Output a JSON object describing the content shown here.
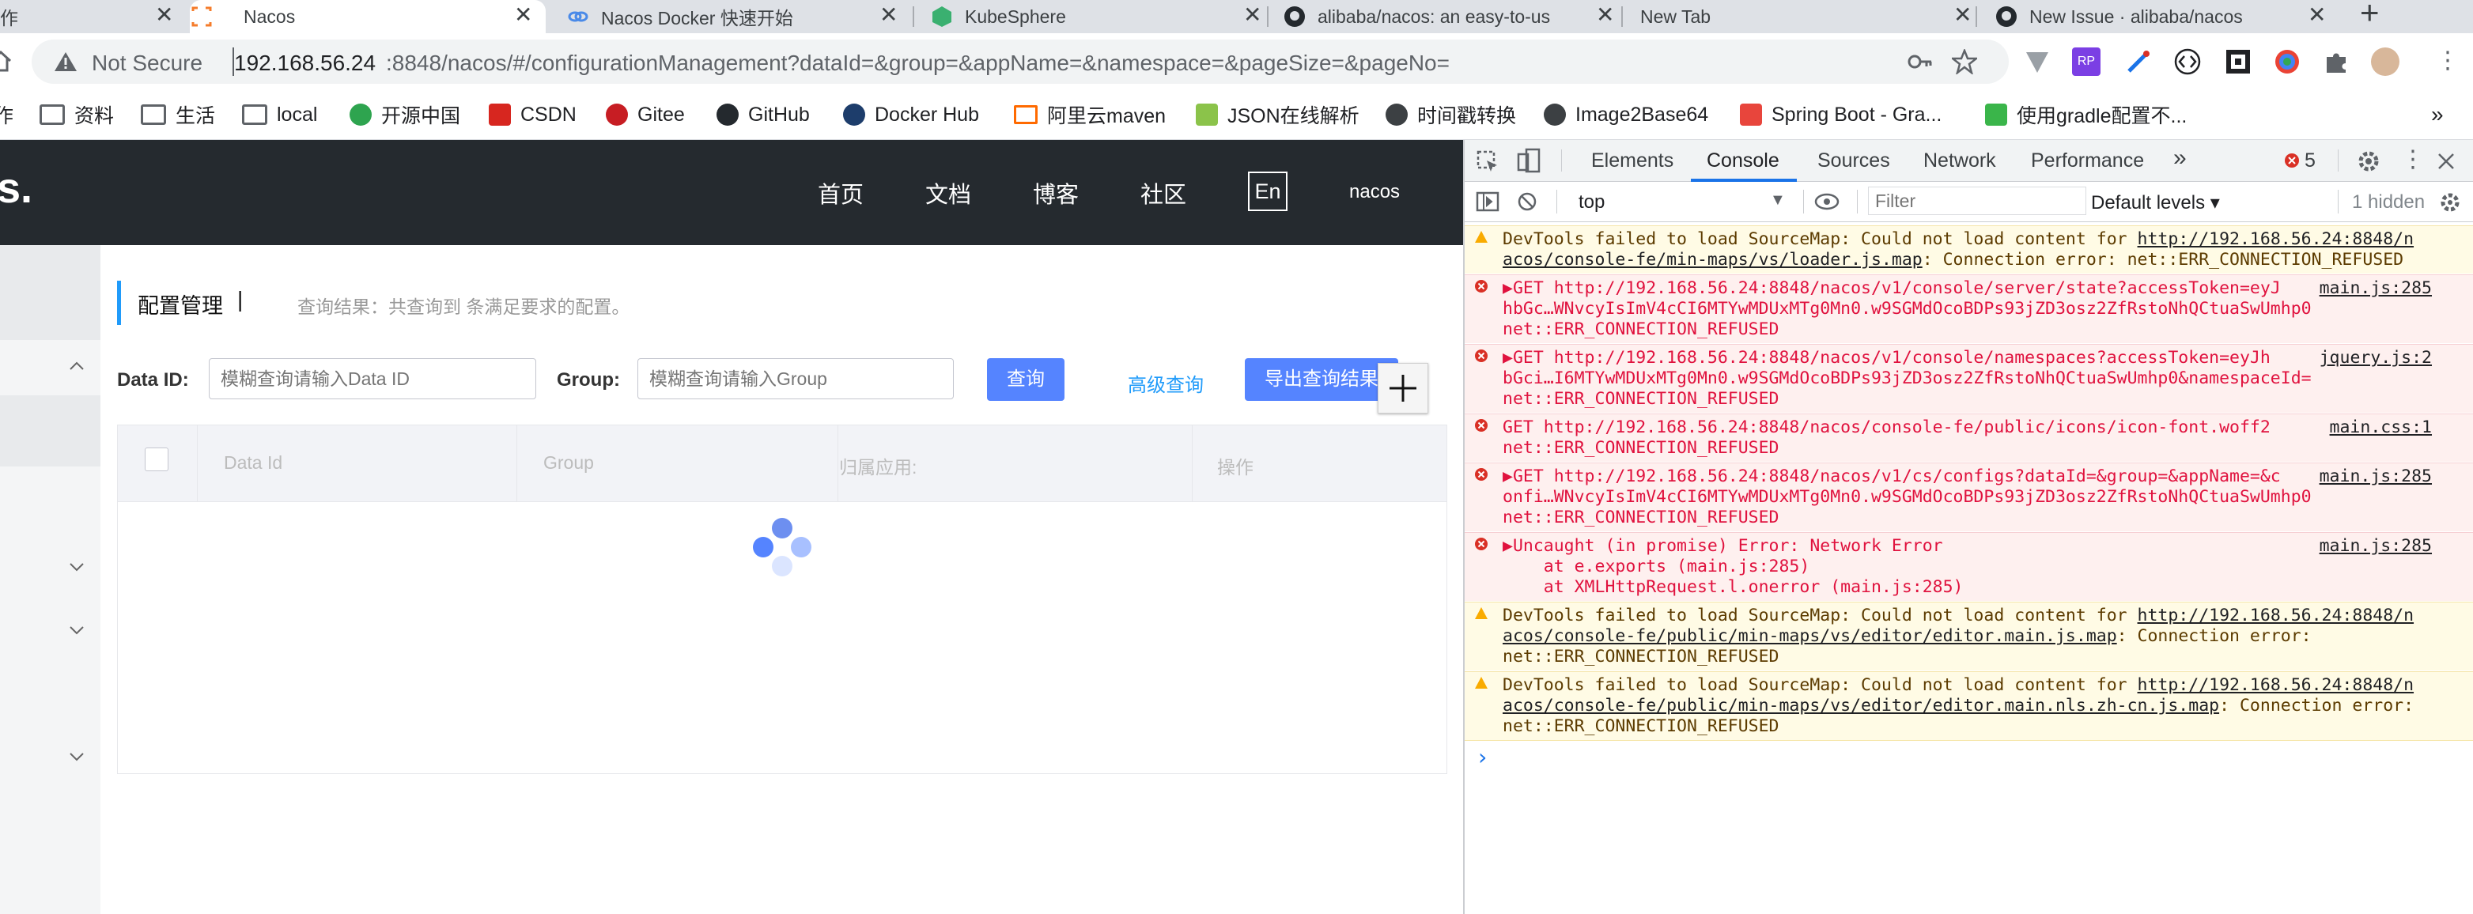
{
  "tabs": [
    {
      "title": "作",
      "close": "✕",
      "active": false
    },
    {
      "title": "Nacos",
      "close": "✕",
      "active": true
    },
    {
      "title": "Nacos Docker 快速开始",
      "close": "✕",
      "active": false
    },
    {
      "title": "KubeSphere",
      "close": "✕",
      "active": false
    },
    {
      "title": "alibaba/nacos: an easy-to-us",
      "close": "✕",
      "active": false
    },
    {
      "title": "New Tab",
      "close": "✕",
      "active": false
    },
    {
      "title": "New Issue · alibaba/nacos",
      "close": "✕",
      "active": false
    }
  ],
  "new_tab_symbol": "+",
  "address": {
    "security_label": "Not Secure",
    "host": "192.168.56.24",
    "path": ":8848/nacos/#/configurationManagement?dataId=&group=&appName=&namespace=&pageSize=&pageNo="
  },
  "extensions": [
    "RP"
  ],
  "bookmarks": [
    {
      "label": "作"
    },
    {
      "label": "资料"
    },
    {
      "label": "生活"
    },
    {
      "label": "local"
    },
    {
      "label": "开源中国"
    },
    {
      "label": "CSDN"
    },
    {
      "label": "Gitee"
    },
    {
      "label": "GitHub"
    },
    {
      "label": "Docker Hub"
    },
    {
      "label": "阿里云maven"
    },
    {
      "label": "JSON在线解析"
    },
    {
      "label": "时间戳转换"
    },
    {
      "label": "Image2Base64"
    },
    {
      "label": "Spring Boot - Gra..."
    },
    {
      "label": "使用gradle配置不..."
    }
  ],
  "bookmarks_more": "»",
  "nacos": {
    "logo_fragment": "s.",
    "nav": [
      "首页",
      "文档",
      "博客",
      "社区"
    ],
    "lang_button": "En",
    "user": "nacos",
    "page_title": "配置管理",
    "title_separator": "|",
    "result_text": "查询结果：共查询到 条满足要求的配置。",
    "dataid_label": "Data ID:",
    "dataid_placeholder": "模糊查询请输入Data ID",
    "group_label": "Group:",
    "group_placeholder": "模糊查询请输入Group",
    "query_button": "查询",
    "advanced_query": "高级查询",
    "export_button": "导出查询结果",
    "table_headers": [
      "Data Id",
      "Group",
      "归属应用:",
      "操作"
    ]
  },
  "devtools": {
    "tabs": [
      "Elements",
      "Console",
      "Sources",
      "Network",
      "Performance"
    ],
    "active_tab": "Console",
    "more_tabs": "»",
    "error_count": "5",
    "context": "top",
    "filter_placeholder": "Filter",
    "levels": "Default levels ▾",
    "hidden": "1 hidden",
    "prompt": "›",
    "messages": [
      {
        "level": "warning",
        "lines": [
          "DevTools failed to load SourceMap: Could not load content for http://192.168.56.24:8848/n",
          "acos/console-fe/min-maps/vs/loader.js.map: Connection error: net::ERR_CONNECTION_REFUSED"
        ],
        "source": ""
      },
      {
        "level": "error",
        "lines": [
          "▶GET http://192.168.56.24:8848/nacos/v1/console/server/state?accessToken=eyJ",
          "hbGc…WNvcyIsImV4cCI6MTYwMDUxMTg0Mn0.w9SGMdOcoBDPs93jZD3osz2ZfRstoNhQCtuaSwUmhp0",
          "net::ERR_CONNECTION_REFUSED"
        ],
        "source": "main.js:285"
      },
      {
        "level": "error",
        "lines": [
          "▶GET http://192.168.56.24:8848/nacos/v1/console/namespaces?accessToken=eyJh",
          "bGci…I6MTYwMDUxMTg0Mn0.w9SGMdOcoBDPs93jZD3osz2ZfRstoNhQCtuaSwUmhp0&namespaceId=",
          "net::ERR_CONNECTION_REFUSED"
        ],
        "source": "jquery.js:2"
      },
      {
        "level": "error",
        "lines": [
          "GET http://192.168.56.24:8848/nacos/console-fe/public/icons/icon-font.woff2",
          "net::ERR_CONNECTION_REFUSED"
        ],
        "source": "main.css:1"
      },
      {
        "level": "error",
        "lines": [
          "▶GET http://192.168.56.24:8848/nacos/v1/cs/configs?dataId=&group=&appName=&c",
          "onfi…WNvcyIsImV4cCI6MTYwMDUxMTg0Mn0.w9SGMdOcoBDPs93jZD3osz2ZfRstoNhQCtuaSwUmhp0",
          "net::ERR_CONNECTION_REFUSED"
        ],
        "source": "main.js:285"
      },
      {
        "level": "error",
        "lines": [
          "▶Uncaught (in promise) Error: Network Error",
          "    at e.exports (main.js:285)",
          "    at XMLHttpRequest.l.onerror (main.js:285)"
        ],
        "source": "main.js:285"
      },
      {
        "level": "warning",
        "lines": [
          "DevTools failed to load SourceMap: Could not load content for http://192.168.56.24:8848/n",
          "acos/console-fe/public/min-maps/vs/editor/editor.main.js.map: Connection error:",
          "net::ERR_CONNECTION_REFUSED"
        ],
        "source": ""
      },
      {
        "level": "warning",
        "lines": [
          "DevTools failed to load SourceMap: Could not load content for http://192.168.56.24:8848/n",
          "acos/console-fe/public/min-maps/vs/editor/editor.main.nls.zh-cn.js.map: Connection error:",
          "net::ERR_CONNECTION_REFUSED"
        ],
        "source": ""
      }
    ]
  },
  "colors": {
    "nacos_header": "#252a2f",
    "primary_button": "#5584ff",
    "accent_blue": "#209bfa",
    "error_bg": "#fef0ef",
    "warning_bg": "#fffbe5"
  }
}
